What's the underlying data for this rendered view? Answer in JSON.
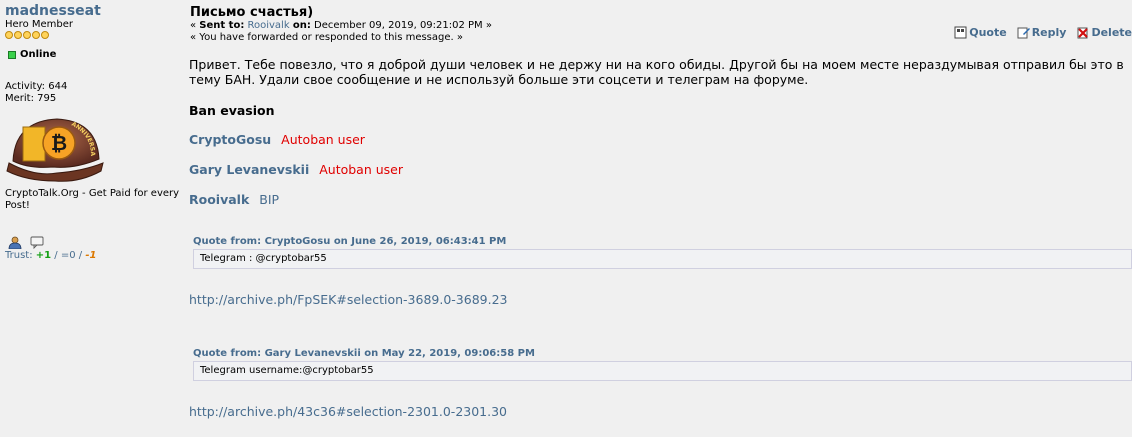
{
  "profile": {
    "username": "madnesseat",
    "rank": "Hero Member",
    "star_count": 5,
    "status": "Online",
    "activity": "Activity: 644",
    "merit": "Merit: 795",
    "avatar_icon": "bitcoin-anniversary-cap-avatar",
    "avatar_text": "ANNIVERSARY",
    "signature": "CryptoTalk.Org - Get Paid for every Post!",
    "trust": {
      "label": "Trust:",
      "positive": "+1",
      "sep1": " / ",
      "neutral": "=0",
      "sep2": " / ",
      "negative": "-1"
    }
  },
  "message": {
    "subject": "Письмо счастья)",
    "sent_prefix": "« ",
    "sent_to_label": "Sent to:",
    "sent_to_user": "Rooivalk",
    "on_label": "on:",
    "date": "December 09, 2019, 09:21:02 PM",
    "sent_suffix": " »",
    "forwarded": "« You have forwarded or responded to this message. »",
    "actions": {
      "quote": "Quote",
      "reply": "Reply",
      "delete": "Delete"
    },
    "body": "Привет. Тебе повезло, что я доброй души человек и не держу ни на кого обиды. Другой бы на моем месте нераздумывая отправил бы это в тему БАН. Удали свое сообщение и не используй больше эти соцсети и телеграм на форуме.",
    "ban_title": "Ban evasion",
    "users": [
      {
        "name": "CryptoGosu",
        "tag": "Autoban user"
      },
      {
        "name": "Gary Levanevskii",
        "tag": "Autoban user"
      },
      {
        "name": "Rooivalk",
        "tag": "BIP"
      }
    ],
    "quotes": [
      {
        "header": "Quote from: CryptoGosu on June 26, 2019, 06:43:41 PM",
        "text": "Telegram : @cryptobar55",
        "link": "http://archive.ph/FpSEK#selection-3689.0-3689.23"
      },
      {
        "header": "Quote from: Gary Levanevskii on May 22, 2019, 09:06:58 PM",
        "text": "Telegram username:@cryptobar55",
        "link": "http://archive.ph/43c36#selection-2301.0-2301.30"
      }
    ]
  },
  "colors": {
    "link": "#476c8e",
    "autoban": "#e00000",
    "background": "#f0f0f0"
  }
}
